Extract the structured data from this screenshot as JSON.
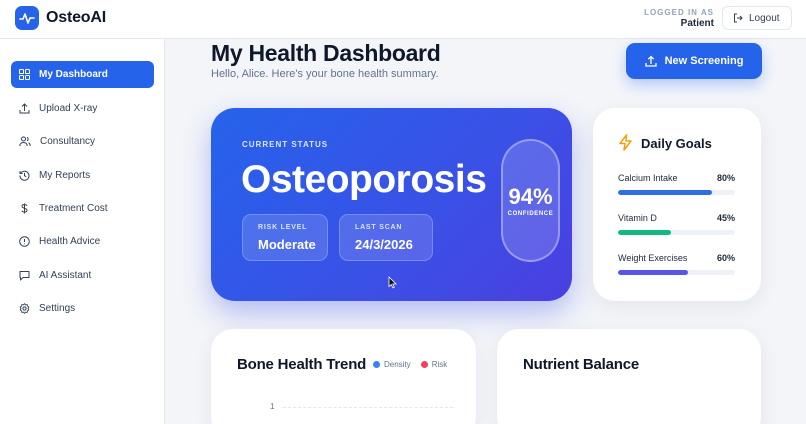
{
  "app": {
    "name": "OsteoAI"
  },
  "header": {
    "logged_in_label": "LOGGED IN AS",
    "role": "Patient",
    "logout_label": "Logout"
  },
  "sidebar": {
    "items": [
      {
        "label": "My Dashboard",
        "icon": "grid-icon",
        "active": true
      },
      {
        "label": "Upload X-ray",
        "icon": "upload-icon"
      },
      {
        "label": "Consultancy",
        "icon": "users-icon"
      },
      {
        "label": "My Reports",
        "icon": "history-icon"
      },
      {
        "label": "Treatment Cost",
        "icon": "dollar-icon"
      },
      {
        "label": "Health Advice",
        "icon": "alert-circle-icon"
      },
      {
        "label": "AI Assistant",
        "icon": "chat-icon"
      },
      {
        "label": "Settings",
        "icon": "gear-icon"
      }
    ]
  },
  "page": {
    "title": "My Health Dashboard",
    "subtitle": "Hello, Alice. Here's your bone health summary.",
    "new_screening_label": "New Screening"
  },
  "status": {
    "label": "CURRENT STATUS",
    "value": "Osteoporosis",
    "risk_label": "RISK LEVEL",
    "risk_value": "Moderate",
    "scan_label": "LAST SCAN",
    "scan_value": "24/3/2026",
    "confidence_value": "94%",
    "confidence_label": "CONFIDENCE"
  },
  "goals": {
    "title": "Daily Goals",
    "items": [
      {
        "label": "Calcium Intake",
        "percent": "80%",
        "fraction": 0.8,
        "color": "#2f6fe4"
      },
      {
        "label": "Vitamin D",
        "percent": "45%",
        "fraction": 0.45,
        "color": "#10b981"
      },
      {
        "label": "Weight Exercises",
        "percent": "60%",
        "fraction": 0.6,
        "color": "#5a55e8"
      }
    ]
  },
  "trend": {
    "title": "Bone Health Trend",
    "legend": [
      {
        "label": "Density",
        "color": "#3b82f6"
      },
      {
        "label": "Risk",
        "color": "#f43f5e"
      }
    ],
    "y_tick": "1"
  },
  "nutrient": {
    "title": "Nutrient Balance"
  }
}
